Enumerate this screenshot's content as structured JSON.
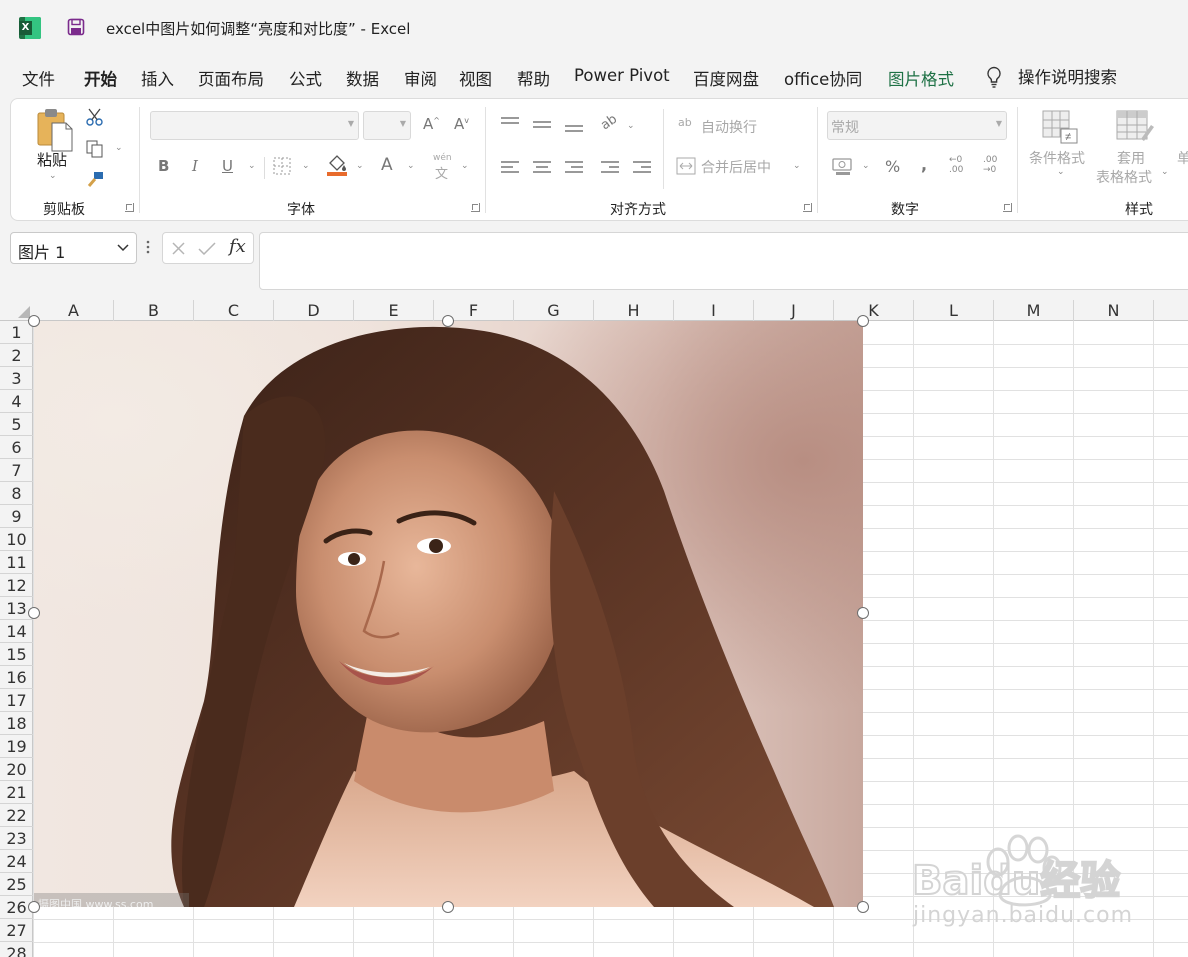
{
  "titlebar": {
    "doc_title": "excel中图片如何调整“亮度和对比度” - Excel"
  },
  "menu_tabs": [
    {
      "label": "文件"
    },
    {
      "label": "开始"
    },
    {
      "label": "插入"
    },
    {
      "label": "页面布局"
    },
    {
      "label": "公式"
    },
    {
      "label": "数据"
    },
    {
      "label": "审阅"
    },
    {
      "label": "视图"
    },
    {
      "label": "帮助"
    },
    {
      "label": "Power Pivot"
    },
    {
      "label": "百度网盘"
    },
    {
      "label": "office协同"
    },
    {
      "label": "图片格式"
    },
    {
      "label": "操作说明搜索"
    }
  ],
  "ribbon": {
    "clipboard": {
      "paste_label": "粘贴",
      "group_label": "剪贴板"
    },
    "font": {
      "bold": "B",
      "italic": "I",
      "underline": "U",
      "font_color_glyph": "A",
      "phonetic_top": "wén",
      "phonetic_bottom": "文",
      "group_label": "字体"
    },
    "alignment": {
      "wrap_text": "自动换行",
      "merge_center": "合并后居中",
      "group_label": "对齐方式",
      "wrap_icon_text": "ab"
    },
    "number": {
      "format_value": "常规",
      "percent": "%",
      "comma": ",",
      "inc_decimal": "←0 .00",
      "dec_decimal": ".00 →0",
      "group_label": "数字"
    },
    "styles": {
      "conditional_format": "条件格式",
      "table_format_top": "套用",
      "table_format_bottom": "表格格式",
      "cell_styles_partial": "单",
      "group_label": "样式"
    }
  },
  "formula_bar": {
    "name_box": "图片 1",
    "fx": "fx",
    "content": ""
  },
  "sheet": {
    "columns": [
      "A",
      "B",
      "C",
      "D",
      "E",
      "F",
      "G",
      "H",
      "I",
      "J",
      "K",
      "L",
      "M",
      "N"
    ],
    "rows": [
      "1",
      "2",
      "3",
      "4",
      "5",
      "6",
      "7",
      "8",
      "9",
      "10",
      "11",
      "12",
      "13",
      "14",
      "15",
      "16",
      "17",
      "18",
      "19",
      "20",
      "21",
      "22",
      "23",
      "24",
      "25",
      "26",
      "27",
      "28"
    ]
  },
  "picture": {
    "name": "图片 1",
    "photo_watermark": "摄图中国 www.ss.com"
  },
  "overlay_watermark": {
    "brand": "Baidu经验",
    "url": "jingyan.baidu.com"
  },
  "colors": {
    "excel_green": "#1e7145",
    "ribbon_bg": "#ffffff",
    "chrome_bg": "#f3f3f3"
  }
}
